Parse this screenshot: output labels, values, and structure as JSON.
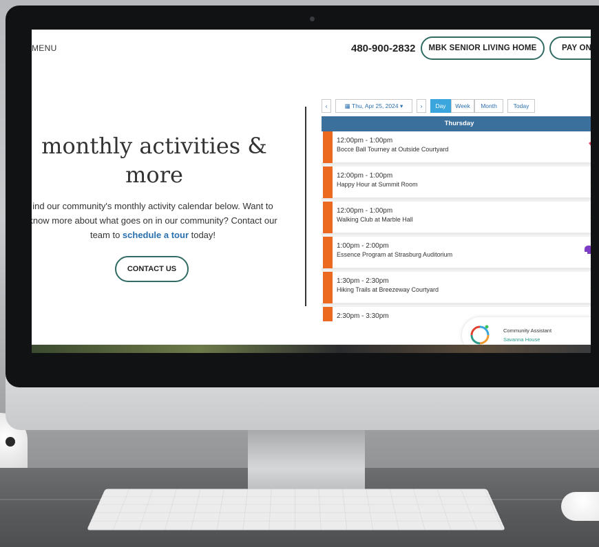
{
  "nav": {
    "menu": "MENU",
    "phone": "480-900-2832",
    "button1": "MBK SENIOR LIVING HOME",
    "button2": "PAY ON"
  },
  "hero": {
    "title": "monthly activities & more",
    "body_part1": "ind our community's monthly activity calendar below. Want to know more about what goes on in our community? Contact our team to ",
    "body_link": "schedule a tour",
    "body_part2": " today!",
    "contact_button": "CONTACT US"
  },
  "calendar": {
    "prev": "‹",
    "date": "Thu, Apr 25, 2024 ▾",
    "next": "›",
    "view_day": "Day",
    "view_week": "Week",
    "view_month": "Month",
    "today": "Today",
    "day_header": "Thursday",
    "accent_color": "#ec6a1f",
    "header_color": "#3b6f9c",
    "events": [
      {
        "time": "12:00pm - 1:00pm",
        "name": "Bocce Ball Tourney at Outside Courtyard",
        "icon": "handshake-icon"
      },
      {
        "time": "12:00pm - 1:00pm",
        "name": "Happy Hour at Summit Room",
        "icon": "figure-icon"
      },
      {
        "time": "12:00pm - 1:00pm",
        "name": "Walking Club at Marble Hall",
        "icon": "figure-icon"
      },
      {
        "time": "1:00pm - 2:00pm",
        "name": "Essence Program at Strasburg Auditorium",
        "icon": "head-icon"
      },
      {
        "time": "1:30pm - 2:30pm",
        "name": "Hiking Trails at Breezeway Courtyard",
        "icon": "figure-icon"
      },
      {
        "time": "2:30pm - 3:30pm",
        "name": "",
        "icon": ""
      }
    ]
  },
  "assistant": {
    "title": "Community Assistant",
    "subtitle": "Savanna House"
  }
}
